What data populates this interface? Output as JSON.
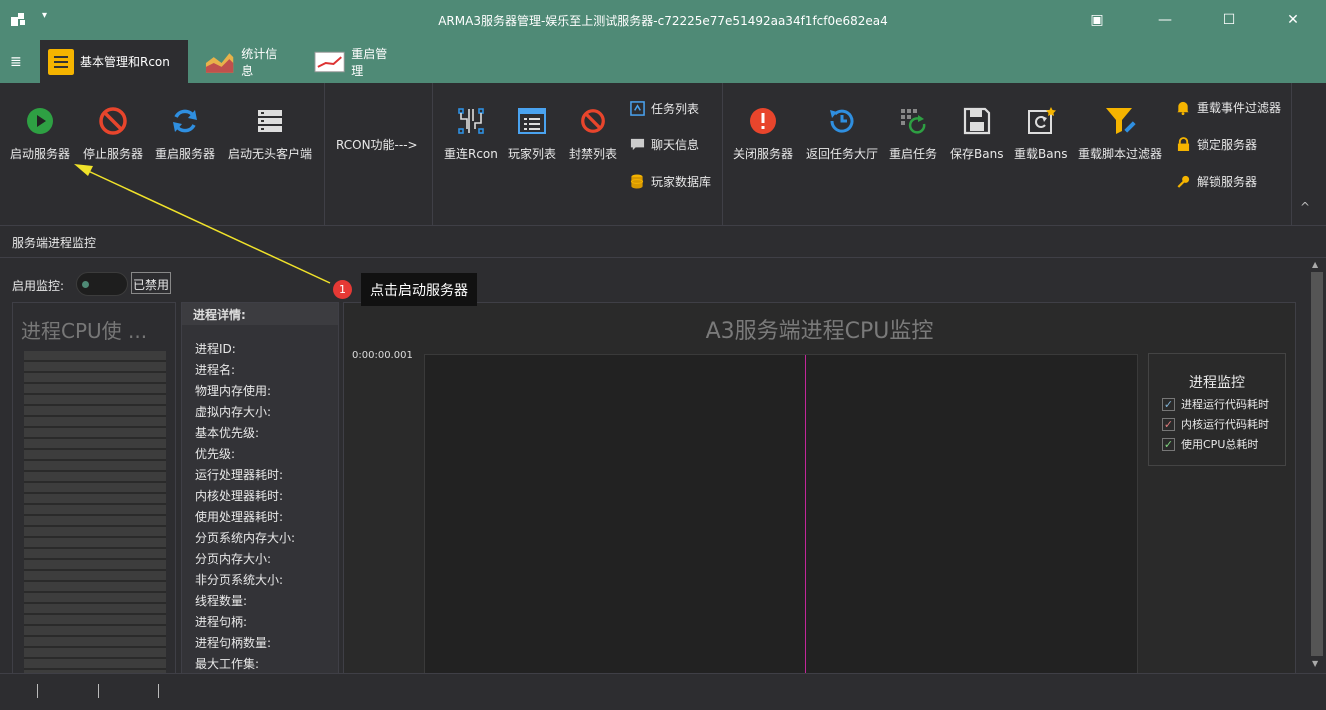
{
  "window": {
    "title": "ARMA3服务器管理-娱乐至上测试服务器-c72225e77e51492aa34f1fcf0e682ea4",
    "minimize": "—",
    "maximize": "☐",
    "close": "✕",
    "restore_icon": "▣",
    "quick_dropdown": "▾"
  },
  "tabs": [
    {
      "label": "基本管理和Rcon",
      "icon": "list-icon",
      "active": true
    },
    {
      "label": "统计信息",
      "icon": "chart-icon",
      "active": false
    },
    {
      "label": "重启管理",
      "icon": "restart-chart-icon",
      "active": false
    }
  ],
  "menu_icon": "≣",
  "ribbon": {
    "buttons": {
      "start": "启动服务器",
      "stop": "停止服务器",
      "restart": "重启服务器",
      "headless": "启动无头客户端",
      "reconnect": "重连Rcon",
      "players": "玩家列表",
      "bans": "封禁列表",
      "shutdown": "关闭服务器",
      "lobby": "返回任务大厅",
      "restart_mission": "重启任务",
      "save_bans": "保存Bans",
      "reload_bans": "重载Bans",
      "reload_script_filter": "重载脚本过滤器"
    },
    "small": {
      "mission_list": "任务列表",
      "chat": "聊天信息",
      "player_db": "玩家数据库",
      "reload_event_filter": "重载事件过滤器",
      "lock": "锁定服务器",
      "unlock": "解锁服务器"
    },
    "rcon_label": "RCON功能--->",
    "collapse": "^"
  },
  "section_title": "服务端进程监控",
  "monitor": {
    "label": "启用监控:",
    "toggle_state": "已禁用",
    "gauge_title": "进程CPU使 ...",
    "details_header": "进程详情:",
    "details": [
      "进程ID:",
      "进程名:",
      "物理内存使用:",
      "虚拟内存大小:",
      "基本优先级:",
      "优先级:",
      "运行处理器耗时:",
      "内核处理器耗时:",
      "使用处理器耗时:",
      "分页系统内存大小:",
      "分页内存大小:",
      "非分页系统大小:",
      "线程数量:",
      "进程句柄:",
      "进程句柄数量:",
      "最大工作集:"
    ]
  },
  "chart_data": {
    "type": "line",
    "title": "A3服务端进程CPU监控",
    "y_tick_labels": [
      "0:00:00.001"
    ],
    "series": [
      {
        "name": "进程运行代码耗时",
        "values": []
      },
      {
        "name": "内核运行代码耗时",
        "values": []
      },
      {
        "name": "使用CPU总耗时",
        "values": []
      }
    ],
    "legend_title": "进程监控",
    "legend_position": "right",
    "colors": {
      "marker_line": "#c2279a",
      "check_1": "#7fb3d5",
      "check_2": "#e07b7b",
      "check_3": "#7fd57f"
    }
  },
  "callout": {
    "number": "1",
    "text": "点击启动服务器"
  },
  "colors": {
    "accent": "#4f8a76",
    "background": "#2d2d30"
  }
}
